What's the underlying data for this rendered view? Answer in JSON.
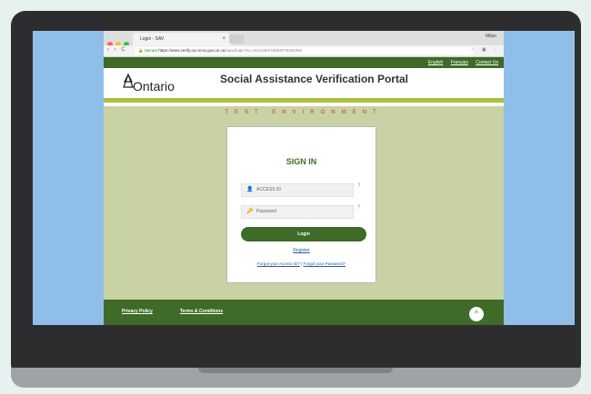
{
  "browser": {
    "tab_title": "Login - SAV",
    "tab_close": "×",
    "user_label": "Milan",
    "secure_label": "Secure",
    "url_main": "https://www.verify.sa.mcss.gov.on.ca",
    "url_rest": "/saav/login?ts=1511200479383070300384",
    "nav_icons": "‹ › C",
    "toolbar_icons": "☆ ▣ ⋮"
  },
  "site": {
    "top_links": [
      "English",
      "Français",
      "Contact Us"
    ],
    "logo_text": "Ontario",
    "portal_title": "Social Assistance Verification Portal",
    "test_banner": "TEST ENVIRONMENT"
  },
  "signin": {
    "title": "SIGN IN",
    "access_id_placeholder": "ACCESS ID",
    "password_placeholder": "Password",
    "help_icon": "?",
    "login_label": "Login",
    "register_label": "Register",
    "forgot_access_id": "Forgot your Access ID?",
    "forgot_separator": "|",
    "forgot_password": "Forgot your Password?"
  },
  "footer": {
    "privacy": "Privacy Policy",
    "terms": "Terms & Conditions",
    "scroll_top_icon": "^"
  },
  "colors": {
    "brand_green": "#3e6b27",
    "accent_green": "#a9bf3f",
    "test_red": "#c63b2b",
    "page_bg": "#c8d2a4"
  }
}
